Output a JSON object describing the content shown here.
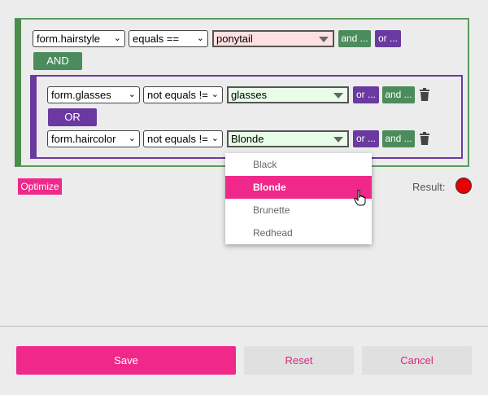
{
  "rule1": {
    "field": "form.hairstyle",
    "operator": "equals ==",
    "value": "ponytail",
    "and_label": "and ...",
    "or_label": "or ..."
  },
  "and_label": "AND",
  "group": {
    "or_label": "OR",
    "rule2": {
      "field": "form.glasses",
      "operator": "not equals !=",
      "value": "glasses",
      "or_label": "or ...",
      "and_label": "and ..."
    },
    "rule3": {
      "field": "form.haircolor",
      "operator": "not equals !=",
      "value": "Blonde",
      "or_label": "or ...",
      "and_label": "and ..."
    }
  },
  "dropdown": {
    "options": [
      "Black",
      "Blonde",
      "Brunette",
      "Redhead"
    ],
    "selected": "Blonde"
  },
  "optimize_label": "Optimize",
  "result_label": "Result:",
  "result_color": "#e60000",
  "footer": {
    "save_label": "Save",
    "reset_label": "Reset",
    "cancel_label": "Cancel"
  }
}
